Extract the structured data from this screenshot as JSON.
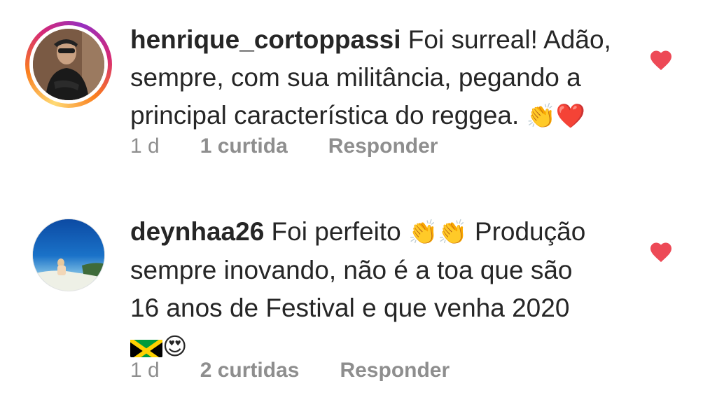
{
  "comments": [
    {
      "username": "henrique_cortoppassi",
      "text_line1": " Foi surreal! Adão,",
      "text_line2": "sempre, com sua militância, pegando a",
      "text_line3": "principal característica do reggea.",
      "emojis": "👏❤️",
      "time": "1 d",
      "likes": "1 curtida",
      "reply": "Responder",
      "avatar_story_ring": true
    },
    {
      "username": "deynhaa26",
      "text_line1": " Foi perfeito ",
      "emojis_inline": "👏👏",
      "text_line1b": " Produção",
      "text_line2": "sempre inovando, não é a toa que são",
      "text_line3": "16 anos de Festival e que venha 2020",
      "emojis_end": "😍",
      "time": "1 d",
      "likes": "2 curtidas",
      "reply": "Responder",
      "avatar_story_ring": false
    }
  ],
  "colors": {
    "text": "#262626",
    "meta": "#8e8e8e",
    "heart": "#ed4956"
  },
  "icons": [
    "heart-icon",
    "jamaica-flag-icon"
  ]
}
